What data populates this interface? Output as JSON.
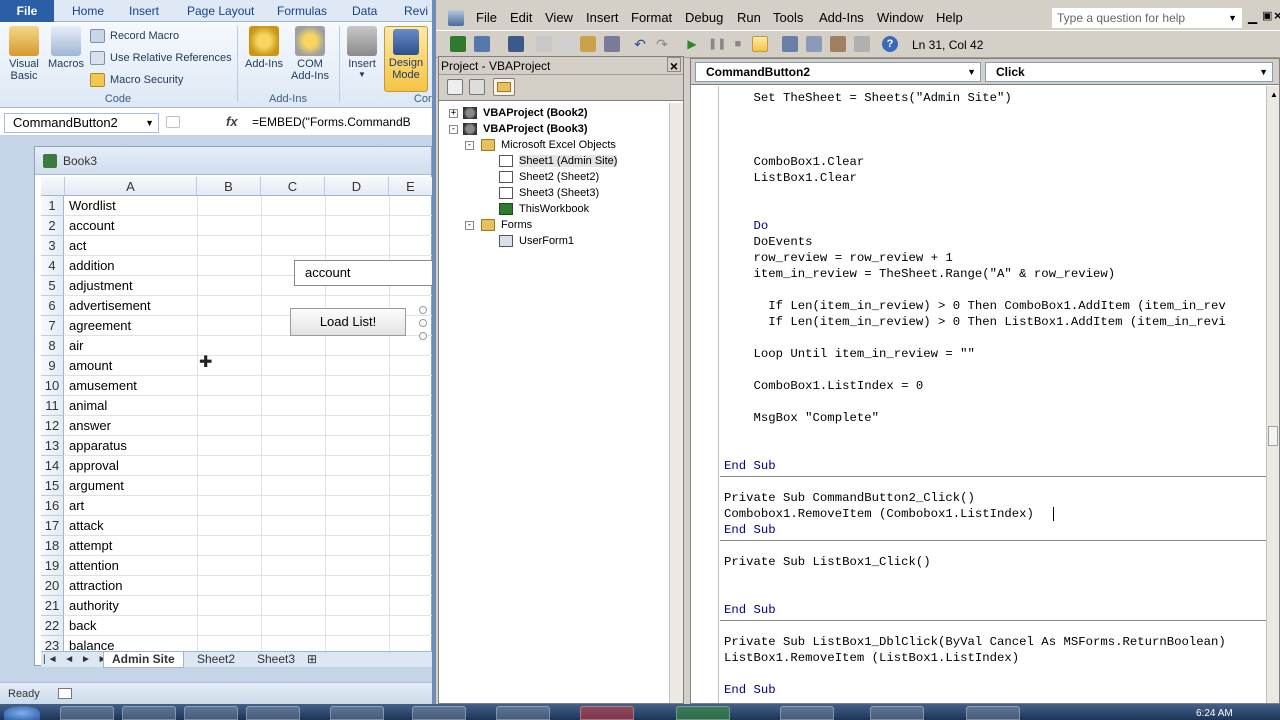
{
  "excel": {
    "tabs": [
      "File",
      "Home",
      "Insert",
      "Page Layout",
      "Formulas",
      "Data",
      "Revi"
    ],
    "ribbon": {
      "visual_basic": "Visual\nBasic",
      "macros": "Macros",
      "record_macro": "Record Macro",
      "relative_refs": "Use Relative References",
      "macro_security": "Macro Security",
      "code_group": "Code",
      "addins": "Add-Ins",
      "com_addins": "COM\nAdd-Ins",
      "addins_group": "Add-Ins",
      "insert": "Insert",
      "design_mode": "Design\nMode",
      "controls_group": "Con"
    },
    "name_box": "CommandButton2",
    "fx": "fx",
    "formula": "=EMBED(\"Forms.CommandB",
    "workbook_title": "Book3",
    "columns": [
      "A",
      "B",
      "C",
      "D",
      "E"
    ],
    "rows": [
      "Wordlist",
      "account",
      "act",
      "addition",
      "adjustment",
      "advertisement",
      "agreement",
      "air",
      "amount",
      "amusement",
      "animal",
      "answer",
      "apparatus",
      "approval",
      "argument",
      "art",
      "attack",
      "attempt",
      "attention",
      "attraction",
      "authority",
      "back",
      "balance"
    ],
    "combo_value": "account",
    "load_button": "Load List!",
    "sheet_tabs": [
      "Admin Site",
      "Sheet2",
      "Sheet3"
    ],
    "status": "Ready"
  },
  "vbe": {
    "menu": [
      "File",
      "Edit",
      "View",
      "Insert",
      "Format",
      "Debug",
      "Run",
      "Tools",
      "Add-Ins",
      "Window",
      "Help"
    ],
    "help_placeholder": "Type a question for help",
    "position": "Ln 31, Col 42",
    "project_title": "Project - VBAProject",
    "tree": [
      {
        "label": "VBAProject (Book2)",
        "bold": true
      },
      {
        "label": "VBAProject (Book3)",
        "bold": true
      },
      {
        "label": "Microsoft Excel Objects",
        "bold": false
      },
      {
        "label": "Sheet1 (Admin Site)",
        "bold": false
      },
      {
        "label": "Sheet2 (Sheet2)",
        "bold": false
      },
      {
        "label": "Sheet3 (Sheet3)",
        "bold": false
      },
      {
        "label": "ThisWorkbook",
        "bold": false
      },
      {
        "label": "Forms",
        "bold": false
      },
      {
        "label": "UserForm1",
        "bold": false
      }
    ],
    "object_combo": "CommandButton2",
    "proc_combo": "Click",
    "code": {
      "l1": "    Set TheSheet = Sheets(\"Admin Site\")",
      "l2": "    ComboBox1.Clear",
      "l3": "    ListBox1.Clear",
      "l4": "    Do",
      "l5": "    DoEvents",
      "l6": "    row_review = row_review + 1",
      "l7": "    item_in_review = TheSheet.Range(\"A\" & row_review)",
      "l8": "      If Len(item_in_review) > 0 Then ComboBox1.AddItem (item_in_rev",
      "l9": "      If Len(item_in_review) > 0 Then ListBox1.AddItem (item_in_revi",
      "l10": "    Loop Until item_in_review = \"\"",
      "l11": "    ComboBox1.ListIndex = 0",
      "l12": "    MsgBox \"Complete\"",
      "l13": "End Sub",
      "l14": "Private Sub CommandButton2_Click()",
      "l15": "Combobox1.RemoveItem (Combobox1.ListIndex)",
      "l16": "End Sub",
      "l17": "Private Sub ListBox1_Click()",
      "l18": "End Sub",
      "l19": "Private Sub ListBox1_DblClick(ByVal Cancel As MSForms.ReturnBoolean)",
      "l20": "ListBox1.RemoveItem (ListBox1.ListIndex)",
      "l21": "End Sub"
    }
  },
  "taskbar": {
    "clock": "6:24 AM"
  }
}
